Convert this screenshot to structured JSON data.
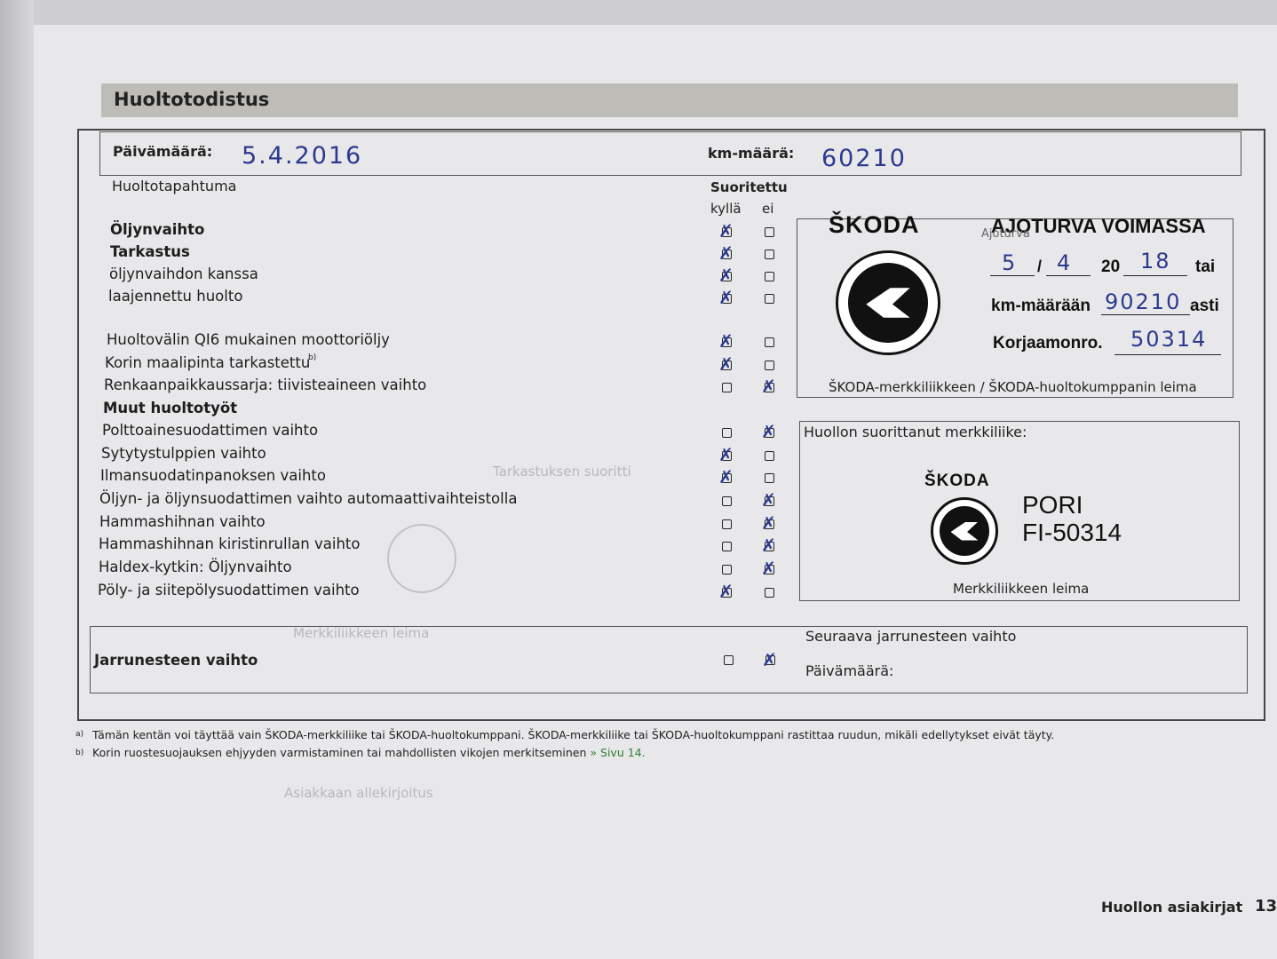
{
  "header": {
    "title": "Huoltotodistus"
  },
  "date_row": {
    "date_label": "Päivämäärä:",
    "date_value": "5.4.2016",
    "km_label": "km-määrä:",
    "km_value": "60210"
  },
  "table": {
    "col_event": "Huoltotapahtuma",
    "col_done": "Suoritettu",
    "col_yes": "kyllä",
    "col_no": "ei"
  },
  "tasks": [
    {
      "label": "Öljynvaihto",
      "bold": true,
      "yes": true
    },
    {
      "label": "Tarkastus",
      "bold": true,
      "yes": true
    },
    {
      "label": "öljynvaihdon kanssa",
      "bold": false,
      "yes": true
    },
    {
      "label": "laajennettu huolto",
      "bold": false,
      "yes": true
    },
    {
      "label": "Huoltovälin QI6 mukainen moottoriöljy",
      "bold": false,
      "yes": true
    },
    {
      "label": "Korin maalipinta tarkastettu",
      "bold": false,
      "yes": true
    },
    {
      "label": "Renkaanpaikkaussarja: tiivisteaineen vaihto",
      "bold": false,
      "yes": false
    },
    {
      "label": "Muut huoltotyöt",
      "bold": true,
      "header": true
    },
    {
      "label": "Polttoainesuodattimen vaihto",
      "bold": false,
      "yes": false
    },
    {
      "label": "Sytytystulppien vaihto",
      "bold": false,
      "yes": true
    },
    {
      "label": "Ilmansuodatinpanoksen vaihto",
      "bold": false,
      "yes": true
    },
    {
      "label": "Öljyn- ja öljynsuodattimen vaihto automaattivaihteistolla",
      "bold": false,
      "yes": false
    },
    {
      "label": "Hammashihnan vaihto",
      "bold": false,
      "yes": false
    },
    {
      "label": "Hammashihnan kiristinrullan vaihto",
      "bold": false,
      "yes": false
    },
    {
      "label": "Haldex-kytkin: Öljynvaihto",
      "bold": false,
      "yes": false
    },
    {
      "label": "Pöly- ja siitepölysuodattimen vaihto",
      "bold": false,
      "yes": true
    }
  ],
  "superscripts": {
    "b": "b)",
    "a": "a)"
  },
  "ajoturva": {
    "brand": "ŠKODA",
    "title": "AJOTURVA VOIMASSA",
    "printed_label": "Ajoturva",
    "day": "5",
    "month": "4",
    "year_prefix": "20",
    "year_suffix": "18",
    "until_word": "tai",
    "km_label": "km-määrään",
    "km_value": "90210",
    "km_suffix": "asti",
    "shop_label": "Korjaamonro.",
    "shop_value": "50314",
    "caption": "ŠKODA-merkkiliikkeen / ŠKODA-huoltokumppanin leima"
  },
  "dealer": {
    "label": "Huollon suorittanut merkkiliike:",
    "brand": "ŠKODA",
    "city": "PORI",
    "code": "FI-50314",
    "caption": "Merkkiliikkeen leima"
  },
  "brake": {
    "label": "Jarrunesteen vaihto",
    "next_label": "Seuraava jarrunesteen vaihto",
    "date_label": "Päivämäärä:"
  },
  "footnotes": {
    "a": "Tämän kentän voi täyttää vain ŠKODA-merkkiliike tai ŠKODA-huoltokumppani. ŠKODA-merkkiliike tai ŠKODA-huoltokumppani rastittaa ruudun, mikäli edellytykset eivät täyty.",
    "b_text": "Korin ruostesuojauksen ehjyyden varmistaminen tai mahdollisten vikojen merkitseminen ",
    "b_link": "» Sivu 14."
  },
  "footer": {
    "section": "Huollon asiakirjat",
    "page": "13"
  },
  "colors": {
    "ink": "#2b3a8f",
    "title_bar": "#bdbcb7",
    "paper": "#e8e8ea",
    "link": "#2e7d32"
  }
}
